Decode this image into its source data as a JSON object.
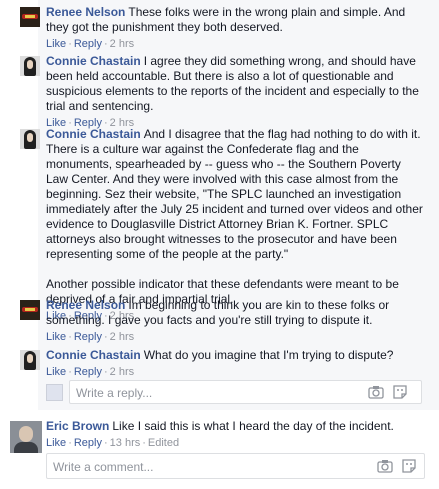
{
  "replies": [
    {
      "author": "Renee Nelson",
      "paragraphs": [
        "These folks were in the wrong plain and simple. And they got the punishment they both deserved."
      ],
      "like": "Like",
      "reply": "Reply",
      "time": "2 hrs"
    },
    {
      "author": "Connie Chastain",
      "paragraphs": [
        "I agree they did something wrong, and should have been held accountable. But there is also a lot of questionable and suspicious elements to the reports of the incident and especially to the trial and sentencing."
      ],
      "like": "Like",
      "reply": "Reply",
      "time": "2 hrs"
    },
    {
      "author": "Connie Chastain",
      "paragraphs": [
        "And I disagree that the flag had nothing to do with it. There is a culture war against the Confederate flag and the monuments, spearheaded by -- guess who -- the Southern Poverty Law Center. And they were involved with this case almost from the beginning. Sez their website, \"The SPLC launched an investigation immediately after the July 25 incident and turned over videos and other evidence to Douglasville District Attorney Brian K. Fortner. SPLC attorneys also brought witnesses to the prosecutor and have been representing some of the people at the party.\"",
        "Another possible indicator that these defendants were meant to be deprived of a fair and impartial trial."
      ],
      "like": "Like",
      "reply": "Reply",
      "time": "2 hrs"
    },
    {
      "author": "Renee Nelson",
      "paragraphs": [
        "Im beginning to think you are kin to these folks or something. I gave you facts and you're still trying to dispute it."
      ],
      "like": "Like",
      "reply": "Reply",
      "time": "2 hrs"
    },
    {
      "author": "Connie Chastain",
      "paragraphs": [
        "What do you imagine that I'm trying to dispute?"
      ],
      "like": "Like",
      "reply": "Reply",
      "time": "2 hrs"
    }
  ],
  "reply_box": {
    "placeholder": "Write a reply...",
    "camera_icon": "camera-icon",
    "sticker_icon": "sticker-icon"
  },
  "eric": {
    "author": "Eric Brown",
    "text": "Like I said this is what I heard the day of the incident.",
    "like": "Like",
    "reply": "Reply",
    "time": "13 hrs",
    "edited": "Edited"
  },
  "comment_box": {
    "placeholder": "Write a comment...",
    "camera_icon": "camera-icon",
    "sticker_icon": "sticker-icon"
  },
  "colors": {
    "link": "#3b5998",
    "meta": "#90949c",
    "thread_bg": "#f6f7f9",
    "border": "#dddfe2"
  }
}
